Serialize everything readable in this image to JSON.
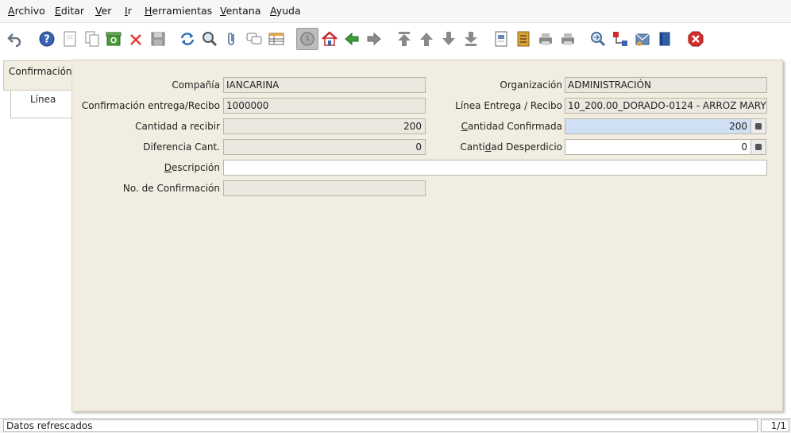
{
  "menu": {
    "archivo": {
      "first": "A",
      "rest": "rchivo"
    },
    "editar": {
      "first": "E",
      "rest": "ditar"
    },
    "ver": {
      "first": "V",
      "rest": "er"
    },
    "ir": {
      "first": "I",
      "rest": "r"
    },
    "herramientas": {
      "first": "H",
      "rest": "erramientas"
    },
    "ventana": {
      "first": "V",
      "rest": "entana"
    },
    "ayuda": {
      "first": "A",
      "rest": "yuda"
    }
  },
  "toolbar": {
    "icons": [
      "undo-icon",
      "help-icon",
      "new-icon",
      "copy-icon",
      "delete-icon",
      "delete-record-icon",
      "save-icon",
      "refresh-icon",
      "find-icon",
      "attachment-icon",
      "chat-icon",
      "grid-toggle-icon",
      "history-icon",
      "home-icon",
      "back-icon",
      "forward-icon",
      "first-record-icon",
      "previous-record-icon",
      "next-record-icon",
      "last-record-icon",
      "report-icon",
      "archive-icon",
      "print-preview-icon",
      "print-icon",
      "zoom-across-icon",
      "workflow-icon",
      "request-icon",
      "product-info-icon",
      "exit-icon"
    ]
  },
  "tabs": {
    "confirmacion": "Confirmación",
    "linea": "Línea"
  },
  "form": {
    "compania": {
      "label": "Compañía",
      "value": "IANCARINA"
    },
    "organizacion": {
      "label": "Organización",
      "value": "ADMINISTRACIÓN"
    },
    "confirmacion_entrega": {
      "label": "Confirmación entrega/Recibo",
      "value": "1000000"
    },
    "linea_entrega": {
      "label": "Línea Entrega / Recibo",
      "value": "10_200.00_DORADO-0124 - ARROZ MARY"
    },
    "cantidad_recibir": {
      "label": "Cantidad a recibir",
      "value": "200"
    },
    "cantidad_confirmada": {
      "label_pre": "",
      "label_u": "C",
      "label_post": "antidad Confirmada",
      "value": "200"
    },
    "diferencia": {
      "label": "Diferencia Cant.",
      "value": "0"
    },
    "cantidad_desperdicio": {
      "label_pre": "Canti",
      "label_u": "d",
      "label_post": "ad Desperdicio",
      "value": "0"
    },
    "descripcion": {
      "label_pre": "",
      "label_u": "D",
      "label_post": "escripción",
      "value": ""
    },
    "no_confirmacion": {
      "label": "No. de Confirmación",
      "value": ""
    }
  },
  "status": {
    "text": "Datos refrescados",
    "record": "1/1"
  },
  "colors": {
    "panel": "#f1ede0",
    "readonly_field": "#ebe9df",
    "required_field": "#cfe0f5"
  }
}
